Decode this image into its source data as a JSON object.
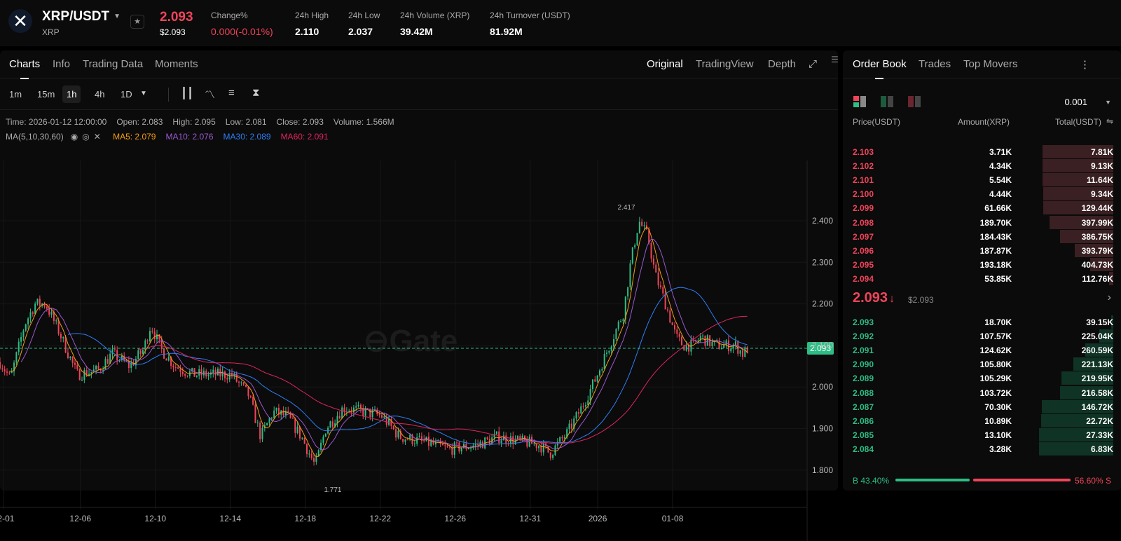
{
  "header": {
    "pair": "XRP/USDT",
    "base": "XRP",
    "last_price": "2.093",
    "last_price_usd": "$2.093",
    "stats": [
      {
        "label": "Change%",
        "value": "0.000(-0.01%)",
        "neg": true
      },
      {
        "label": "24h High",
        "value": "2.110"
      },
      {
        "label": "24h Low",
        "value": "2.037"
      },
      {
        "label": "24h Volume (XRP)",
        "value": "39.42M"
      },
      {
        "label": "24h Turnover (USDT)",
        "value": "81.92M"
      }
    ]
  },
  "left_tabs": [
    "Charts",
    "Info",
    "Trading Data",
    "Moments"
  ],
  "view_tabs": [
    "Original",
    "TradingView",
    "Depth"
  ],
  "timeframes": [
    "1m",
    "15m",
    "1h",
    "4h",
    "1D"
  ],
  "ohlc": {
    "time": "Time: 2026-01-12 12:00:00",
    "open": "Open: 2.083",
    "high": "High: 2.095",
    "low": "Low: 2.081",
    "close": "Close: 2.093",
    "volume": "Volume: 1.566M"
  },
  "ma": {
    "label": "MA(5,10,30,60)",
    "ma5": "MA5: 2.079",
    "ma10": "MA10: 2.076",
    "ma30": "MA30: 2.089",
    "ma60": "MA60: 2.091"
  },
  "colors": {
    "up": "#2ebd85",
    "down": "#f0445a",
    "ma5": "#f39c12",
    "ma10": "#9b59d0",
    "ma30": "#2f7ff5",
    "ma60": "#e0245e"
  },
  "chart_data": {
    "type": "candlestick",
    "ylim": [
      1.72,
      2.56
    ],
    "y_ticks": [
      "2.400",
      "2.300",
      "2.200",
      "2.100",
      "2.000",
      "1.900",
      "1.800"
    ],
    "x_ticks": [
      {
        "label": "12-01",
        "day": 0.9
      },
      {
        "label": "12-06",
        "day": 5
      },
      {
        "label": "12-10",
        "day": 9
      },
      {
        "label": "12-14",
        "day": 13
      },
      {
        "label": "12-18",
        "day": 17
      },
      {
        "label": "12-22",
        "day": 21
      },
      {
        "label": "12-26",
        "day": 25
      },
      {
        "label": "12-31",
        "day": 29
      },
      {
        "label": "2026",
        "day": 32.6
      },
      {
        "label": "01-08",
        "day": 36.6
      }
    ],
    "close_path": [
      [
        0.71,
        2.06
      ],
      [
        1.27,
        2.02
      ],
      [
        2.02,
        2.15
      ],
      [
        2.58,
        2.2
      ],
      [
        3.14,
        2.2
      ],
      [
        3.89,
        2.13
      ],
      [
        4.82,
        2.03
      ],
      [
        5.94,
        2.04
      ],
      [
        6.69,
        2.08
      ],
      [
        7.63,
        2.05
      ],
      [
        8.37,
        2.09
      ],
      [
        8.75,
        2.15
      ],
      [
        9.31,
        2.09
      ],
      [
        10.06,
        2.05
      ],
      [
        10.99,
        2.03
      ],
      [
        11.93,
        2.03
      ],
      [
        13.05,
        2.03
      ],
      [
        13.98,
        1.98
      ],
      [
        14.62,
        1.88
      ],
      [
        15.29,
        1.94
      ],
      [
        16.04,
        1.93
      ],
      [
        16.79,
        1.88
      ],
      [
        17.53,
        1.81
      ],
      [
        18.09,
        1.9
      ],
      [
        19.03,
        1.95
      ],
      [
        20.15,
        1.94
      ],
      [
        21.08,
        1.93
      ],
      [
        22.02,
        1.88
      ],
      [
        23.14,
        1.87
      ],
      [
        24.64,
        1.85
      ],
      [
        26.13,
        1.86
      ],
      [
        27.25,
        1.88
      ],
      [
        28.37,
        1.87
      ],
      [
        29.5,
        1.86
      ],
      [
        30.06,
        1.84
      ],
      [
        30.99,
        1.89
      ],
      [
        31.74,
        1.95
      ],
      [
        32.49,
        2.02
      ],
      [
        33.23,
        2.1
      ],
      [
        33.98,
        2.18
      ],
      [
        34.36,
        2.3
      ],
      [
        34.8,
        2.4
      ],
      [
        35.29,
        2.36
      ],
      [
        35.67,
        2.27
      ],
      [
        36.22,
        2.2
      ],
      [
        36.78,
        2.12
      ],
      [
        37.16,
        2.1
      ],
      [
        37.72,
        2.1
      ],
      [
        38.09,
        2.12
      ],
      [
        38.84,
        2.1
      ],
      [
        39.96,
        2.1
      ],
      [
        40.34,
        2.08
      ],
      [
        40.63,
        2.093
      ]
    ],
    "max_label": "2.417",
    "max_value": 2.417,
    "max_day": 34.9,
    "min_label": "1.771",
    "min_value": 1.771,
    "min_day": 17.7,
    "current_price": 2.093,
    "current_label": "2.093",
    "watermark": "Gate"
  },
  "orderbook": {
    "tabs": [
      "Order Book",
      "Trades",
      "Top Movers"
    ],
    "precision": "0.001",
    "headers": [
      "Price(USDT)",
      "Amount(XRP)",
      "Total(USDT)"
    ],
    "asks": [
      [
        "2.103",
        "3.71K",
        "7.81K",
        0.95
      ],
      [
        "2.102",
        "4.34K",
        "9.13K",
        0.95
      ],
      [
        "2.101",
        "5.54K",
        "11.64K",
        0.95
      ],
      [
        "2.100",
        "4.44K",
        "9.34K",
        0.94
      ],
      [
        "2.099",
        "61.66K",
        "129.44K",
        0.94
      ],
      [
        "2.098",
        "189.70K",
        "397.99K",
        0.86
      ],
      [
        "2.097",
        "184.43K",
        "386.75K",
        0.72
      ],
      [
        "2.096",
        "187.87K",
        "393.79K",
        0.52
      ],
      [
        "2.095",
        "193.18K",
        "404.73K",
        0.31
      ],
      [
        "2.094",
        "53.85K",
        "112.76K",
        0.06
      ]
    ],
    "mid_price": "2.093",
    "mid_usd": "$2.093",
    "bids": [
      [
        "2.093",
        "18.70K",
        "39.15K",
        0.03
      ],
      [
        "2.092",
        "107.57K",
        "225.04K",
        0.19
      ],
      [
        "2.091",
        "124.62K",
        "260.59K",
        0.38
      ],
      [
        "2.090",
        "105.80K",
        "221.13K",
        0.54
      ],
      [
        "2.089",
        "105.29K",
        "219.95K",
        0.7
      ],
      [
        "2.088",
        "103.72K",
        "216.58K",
        0.72
      ],
      [
        "2.087",
        "70.30K",
        "146.72K",
        0.96
      ],
      [
        "2.086",
        "10.89K",
        "22.72K",
        0.97
      ],
      [
        "2.085",
        "13.10K",
        "27.33K",
        1.0
      ],
      [
        "2.084",
        "3.28K",
        "6.83K",
        1.0
      ]
    ],
    "buy_pct": "B 43.40%",
    "sell_pct": "56.60% S",
    "buy_ratio": 0.434
  }
}
